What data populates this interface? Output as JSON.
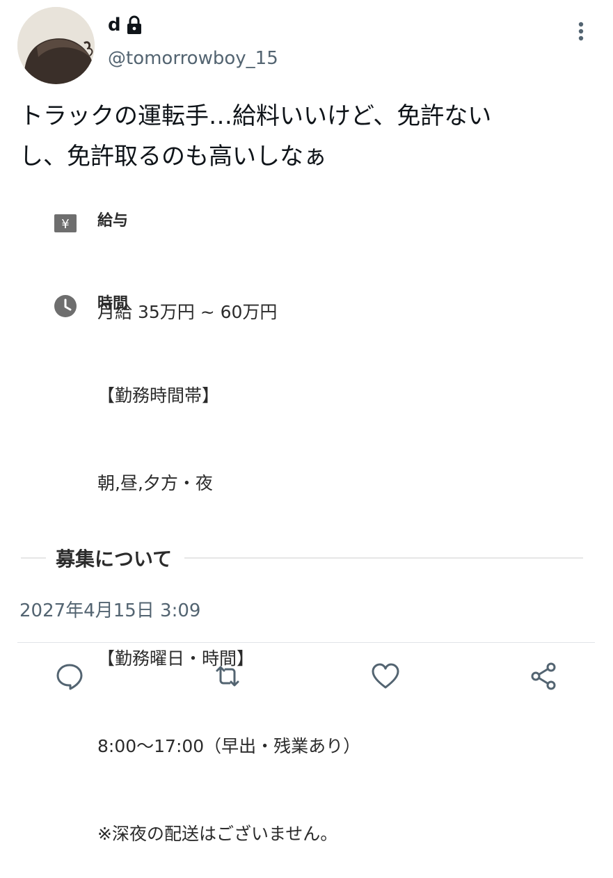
{
  "author": {
    "display_name": "d",
    "handle": "@tomorrowboy_15"
  },
  "tweet": {
    "line1": "トラックの運転手…給料いいけど、免許ない",
    "line2": "し、免許取るのも高いしなぁ"
  },
  "card": {
    "salary": {
      "icon_text": "¥",
      "title": "給与",
      "value": "月給 35万円 ~ 60万円"
    },
    "hours": {
      "title": "時間",
      "lines": [
        "【勤務時間帯】",
        "朝,昼,夕方・夜",
        "",
        "【勤務曜日・時間】",
        "8:00〜17:00（早出・残業あり）",
        "※深夜の配送はございません。"
      ]
    },
    "recruit_heading": "募集について"
  },
  "timestamp": "2027年4月15日 3:09",
  "icons": {
    "lock": "lock-icon",
    "more": "more-vertical-icon",
    "salary": "yen-icon",
    "hours": "clock-icon",
    "reply": "reply-icon",
    "retweet": "retweet-icon",
    "like": "heart-icon",
    "share": "share-icon"
  },
  "colors": {
    "text": "#0f1419",
    "secondary": "#536471",
    "card_text": "#2b2b2b",
    "icon": "#6e6e6e"
  }
}
